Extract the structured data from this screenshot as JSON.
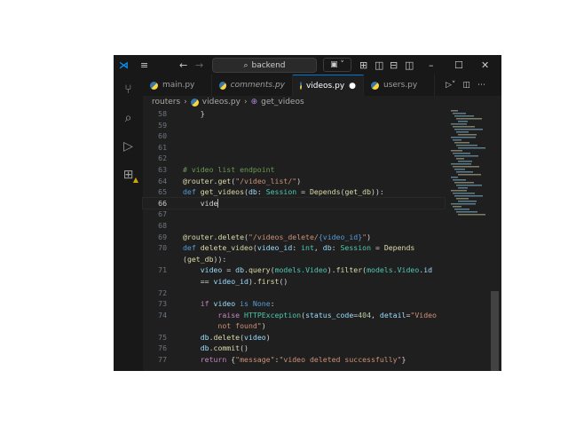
{
  "titlebar": {
    "search": "backend"
  },
  "tabs": [
    {
      "label": "main.py",
      "italic": false
    },
    {
      "label": "comments.py",
      "italic": true
    },
    {
      "label": "videos.py",
      "active": true,
      "modified": true
    },
    {
      "label": "users.py"
    }
  ],
  "breadcrumb": [
    "routers",
    "videos.py",
    "get_videos"
  ],
  "activity_bar": [
    "source-control-icon",
    "search-icon",
    "run-debug-icon",
    "extensions-icon"
  ],
  "colors": {
    "accent": "#0078d4",
    "background": "#1f1f1f",
    "warning_badge": "#cca700"
  },
  "code": [
    {
      "n": "58",
      "t": [
        [
          "d",
          "    }"
        ]
      ]
    },
    {
      "n": "59",
      "t": []
    },
    {
      "n": "60",
      "t": []
    },
    {
      "n": "61",
      "t": []
    },
    {
      "n": "62",
      "t": []
    },
    {
      "n": "63",
      "t": [
        [
          "cm",
          "# video list endpoint"
        ]
      ]
    },
    {
      "n": "64",
      "t": [
        [
          "f",
          "@router"
        ],
        [
          "d",
          "."
        ],
        [
          "f",
          "get"
        ],
        [
          "d",
          "("
        ],
        [
          "s",
          "\"/video_list/\""
        ],
        [
          "d",
          ")"
        ]
      ]
    },
    {
      "n": "65",
      "t": [
        [
          "k",
          "def"
        ],
        [
          "d",
          " "
        ],
        [
          "f",
          "get_videos"
        ],
        [
          "d",
          "("
        ],
        [
          "v",
          "db"
        ],
        [
          "d",
          ": "
        ],
        [
          "t",
          "Session"
        ],
        [
          "d",
          " = "
        ],
        [
          "f",
          "Depends"
        ],
        [
          "d",
          "("
        ],
        [
          "f",
          "get_db"
        ],
        [
          "d",
          "))"
        ],
        [
          "d",
          ":"
        ]
      ]
    },
    {
      "n": "66",
      "cur": true,
      "t": [
        [
          "d",
          "    vide"
        ]
      ]
    },
    {
      "n": "67",
      "t": []
    },
    {
      "n": "68",
      "t": []
    },
    {
      "n": "69",
      "t": [
        [
          "f",
          "@router"
        ],
        [
          "d",
          "."
        ],
        [
          "f",
          "delete"
        ],
        [
          "d",
          "("
        ],
        [
          "s",
          "\"/videos_delete/"
        ],
        [
          "k",
          "{video_id}"
        ],
        [
          "s",
          "\""
        ],
        [
          "d",
          ")"
        ]
      ]
    },
    {
      "n": "70",
      "t": [
        [
          "k",
          "def"
        ],
        [
          "d",
          " "
        ],
        [
          "f",
          "delete_video"
        ],
        [
          "d",
          "("
        ],
        [
          "v",
          "video_id"
        ],
        [
          "d",
          ": "
        ],
        [
          "t",
          "int"
        ],
        [
          "d",
          ", "
        ],
        [
          "v",
          "db"
        ],
        [
          "d",
          ": "
        ],
        [
          "t",
          "Session"
        ],
        [
          "d",
          " = "
        ],
        [
          "f",
          "Depends"
        ]
      ]
    },
    {
      "n": "",
      "t": [
        [
          "d",
          "("
        ],
        [
          "f",
          "get_db"
        ],
        [
          "d",
          "))"
        ],
        [
          "d",
          ":"
        ]
      ]
    },
    {
      "n": "71",
      "t": [
        [
          "v",
          "    video"
        ],
        [
          "d",
          " = "
        ],
        [
          "v",
          "db"
        ],
        [
          "d",
          "."
        ],
        [
          "f",
          "query"
        ],
        [
          "d",
          "("
        ],
        [
          "t",
          "models.Video"
        ],
        [
          "d",
          ")."
        ],
        [
          "f",
          "filter"
        ],
        [
          "d",
          "("
        ],
        [
          "t",
          "models.Video"
        ],
        [
          "d",
          "."
        ],
        [
          "v",
          "id"
        ]
      ]
    },
    {
      "n": "",
      "t": [
        [
          "d",
          "    == "
        ],
        [
          "v",
          "video_id"
        ],
        [
          "d",
          ")."
        ],
        [
          "f",
          "first"
        ],
        [
          "d",
          "()"
        ]
      ]
    },
    {
      "n": "72",
      "t": []
    },
    {
      "n": "73",
      "t": [
        [
          "c",
          "    if"
        ],
        [
          "d",
          " "
        ],
        [
          "v",
          "video"
        ],
        [
          "d",
          " "
        ],
        [
          "k",
          "is"
        ],
        [
          "d",
          " "
        ],
        [
          "k",
          "None"
        ],
        [
          "d",
          ":"
        ]
      ]
    },
    {
      "n": "74",
      "t": [
        [
          "c",
          "        raise"
        ],
        [
          "d",
          " "
        ],
        [
          "t",
          "HTTPException"
        ],
        [
          "d",
          "("
        ],
        [
          "v",
          "status_code"
        ],
        [
          "d",
          "="
        ],
        [
          "n",
          "404"
        ],
        [
          "d",
          ", "
        ],
        [
          "v",
          "detail"
        ],
        [
          "d",
          "="
        ],
        [
          "s",
          "\"Video"
        ]
      ]
    },
    {
      "n": "",
      "t": [
        [
          "s",
          "        not found\""
        ],
        [
          "d",
          ")"
        ]
      ]
    },
    {
      "n": "75",
      "t": [
        [
          "v",
          "    db"
        ],
        [
          "d",
          "."
        ],
        [
          "f",
          "delete"
        ],
        [
          "d",
          "("
        ],
        [
          "v",
          "video"
        ],
        [
          "d",
          ")"
        ]
      ]
    },
    {
      "n": "76",
      "t": [
        [
          "v",
          "    db"
        ],
        [
          "d",
          "."
        ],
        [
          "f",
          "commit"
        ],
        [
          "d",
          "()"
        ]
      ]
    },
    {
      "n": "77",
      "t": [
        [
          "c",
          "    return"
        ],
        [
          "d",
          " {"
        ],
        [
          "s",
          "\"message\""
        ],
        [
          "d",
          ":"
        ],
        [
          "s",
          "\"video deleted successfully\""
        ],
        [
          "d",
          "}"
        ]
      ]
    }
  ]
}
